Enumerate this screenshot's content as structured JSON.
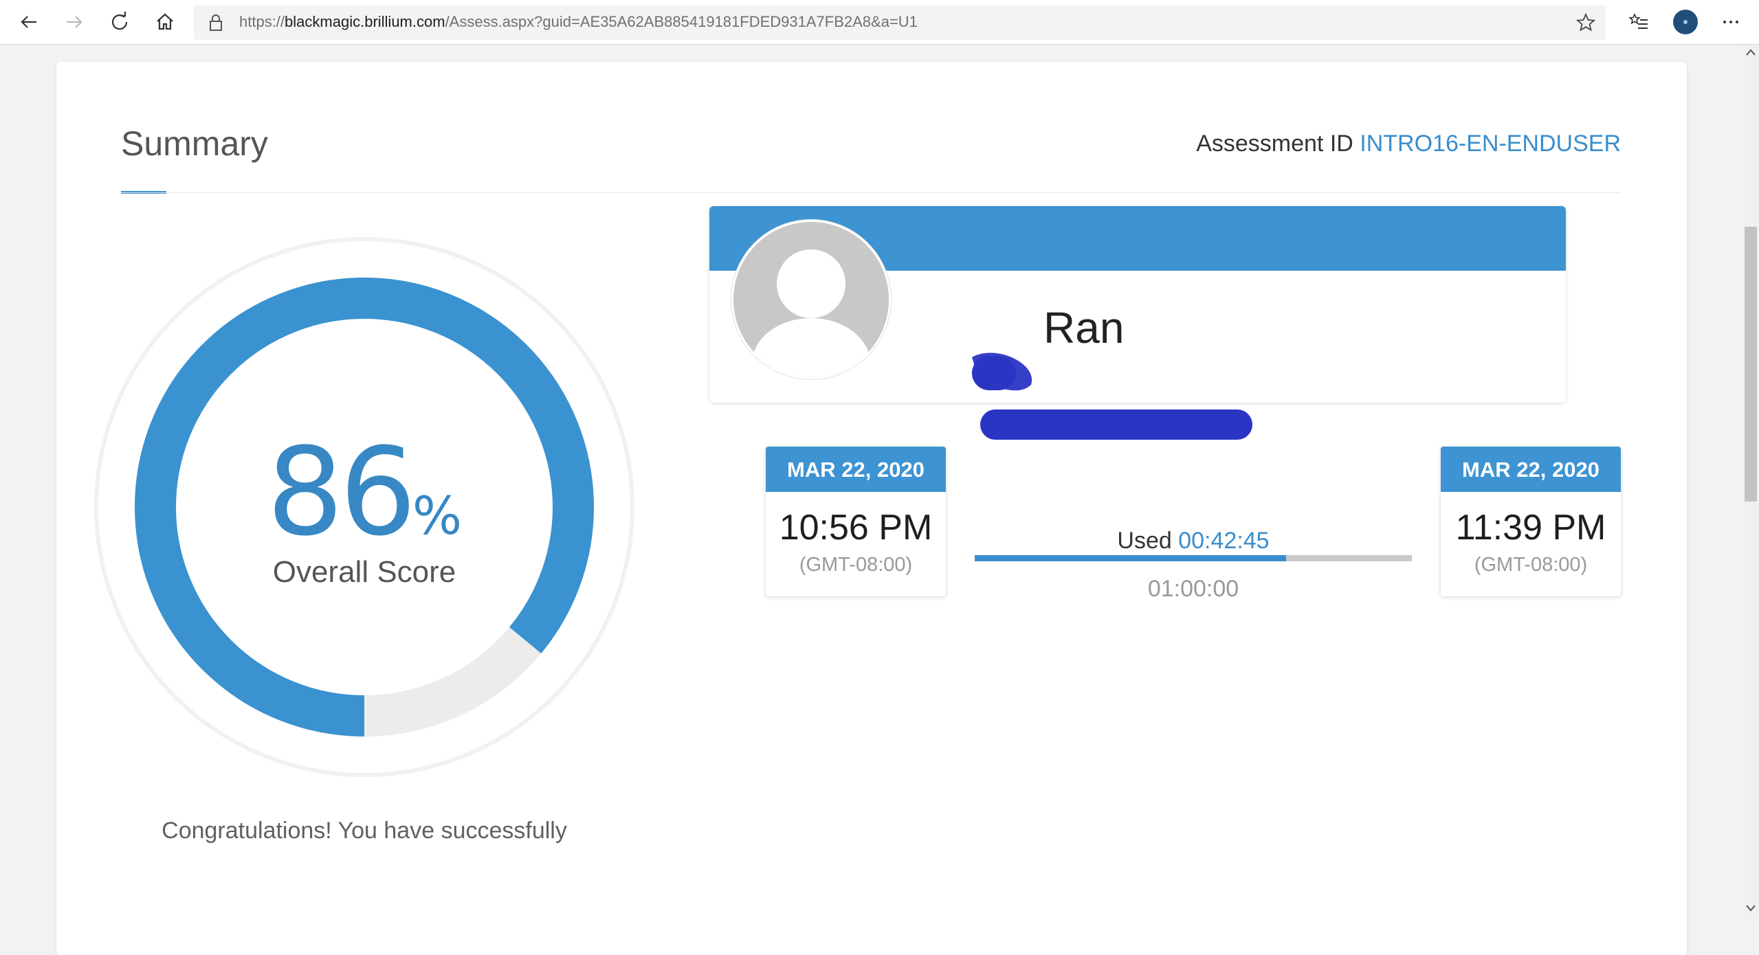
{
  "browser": {
    "url_host_prefix": "https://",
    "url_host": "blackmagic.brillium.com",
    "url_path": "/Assess.aspx?guid=AE35A62AB885419181FDED931A7FB2A8&a=U1",
    "icons": [
      "back-icon",
      "forward-icon",
      "refresh-icon",
      "home-icon",
      "lock-icon",
      "favorite-star-icon",
      "favorites-list-icon",
      "profile-avatar-icon",
      "more-icon"
    ]
  },
  "header": {
    "title": "Summary",
    "assessment_id_label": "Assessment ID",
    "assessment_id_value": "INTRO16-EN-ENDUSER"
  },
  "score": {
    "value": "86",
    "unit": "%",
    "label": "Overall Score",
    "fraction": 0.86
  },
  "message": {
    "text": "Congratulations! You have successfully"
  },
  "profile": {
    "name_visible": "Ran"
  },
  "timing": {
    "start": {
      "date": "MAR 22, 2020",
      "time": "10:56 PM",
      "zone": "(GMT-08:00)"
    },
    "end": {
      "date": "MAR 22, 2020",
      "time": "11:39 PM",
      "zone": "(GMT-08:00)"
    },
    "used_label": "Used",
    "used_value": "00:42:45",
    "limit_value": "01:00:00",
    "used_fraction": 0.7125
  },
  "colors": {
    "accent": "#3a8dcc",
    "band": "#3e93d2",
    "redaction": "#2b35c4"
  }
}
